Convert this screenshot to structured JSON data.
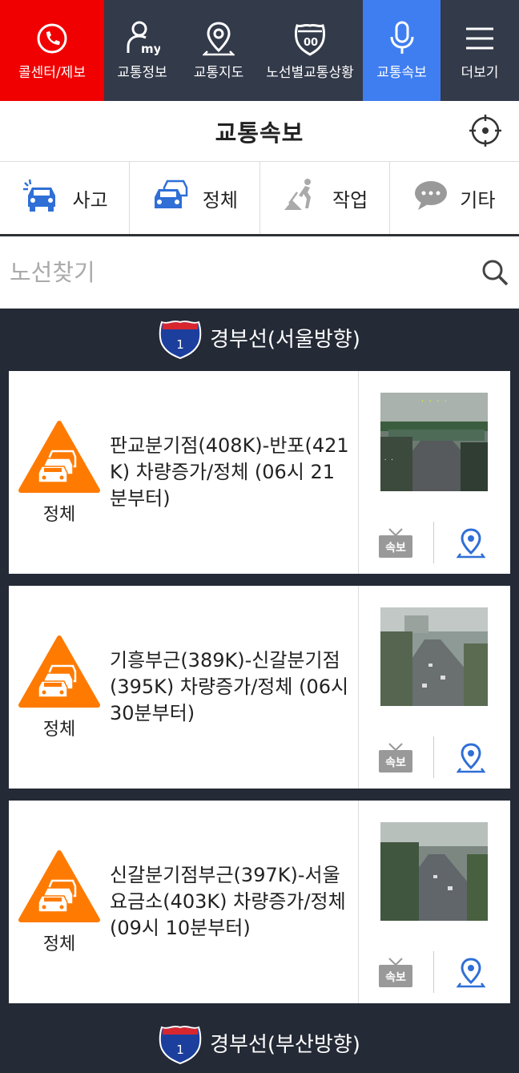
{
  "nav": {
    "items": [
      {
        "id": "call",
        "label": "콜센터/제보",
        "icon": "phone-icon"
      },
      {
        "id": "my",
        "label": "교통정보",
        "icon": "my-user-icon"
      },
      {
        "id": "map",
        "label": "교통지도",
        "icon": "map-pin-icon"
      },
      {
        "id": "route",
        "label": "노선별교통상황",
        "icon": "highway-shield-icon"
      },
      {
        "id": "flash",
        "label": "교통속보",
        "icon": "microphone-icon"
      },
      {
        "id": "more",
        "label": "더보기",
        "icon": "hamburger-icon"
      }
    ],
    "active": "교통속보"
  },
  "header": {
    "title": "교통속보",
    "locate_icon": "locate-icon"
  },
  "categories": [
    {
      "label": "사고",
      "icon": "accident-car-icon"
    },
    {
      "label": "정체",
      "icon": "congestion-cars-icon"
    },
    {
      "label": "작업",
      "icon": "roadwork-icon"
    },
    {
      "label": "기타",
      "icon": "speech-bubble-icon"
    }
  ],
  "search": {
    "placeholder": "노선찾기",
    "value": ""
  },
  "shield_number": "1",
  "routes": [
    {
      "name": "경부선(서울방향)"
    },
    {
      "name": "경부선(부산방향)"
    }
  ],
  "cards": [
    {
      "type": "정체",
      "text": "판교분기점(408K)-반포(421K) 차량증가/정체 (06시 21분부터)",
      "flash_label": "속보"
    },
    {
      "type": "정체",
      "text": "기흥부근(389K)-신갈분기점(395K) 차량증가/정체 (06시 30분부터)",
      "flash_label": "속보"
    },
    {
      "type": "정체",
      "text": "신갈분기점부근(397K)-서울요금소(403K) 차량증가/정체 (09시 10분부터)",
      "flash_label": "속보"
    }
  ],
  "colors": {
    "call_bg": "#f00000",
    "active_tab_bg": "#3f7ef0",
    "nav_bg": "#333a4a",
    "page_bg": "#242a36",
    "warning_orange": "#ff7a00",
    "icon_blue": "#2f6fd6"
  }
}
